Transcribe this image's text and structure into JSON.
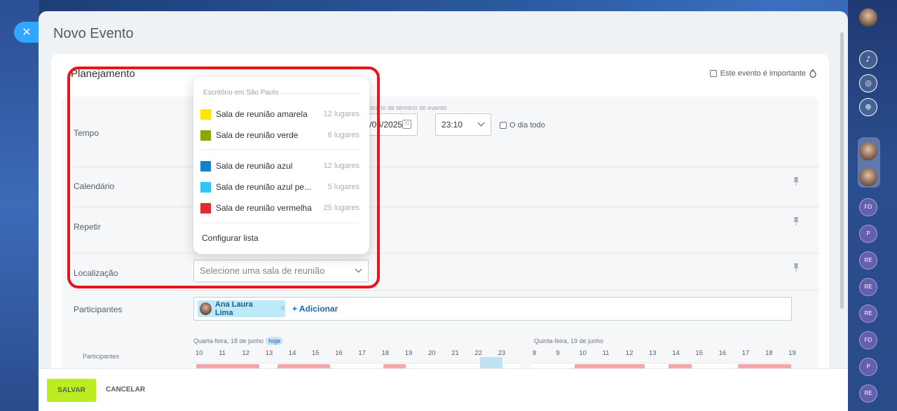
{
  "slider": {
    "title": "Novo Evento"
  },
  "form": {
    "section_title": "Planejamento",
    "important_label": "Este evento é importante",
    "rows": {
      "time_label": "Tempo",
      "calendar_label": "Calendário",
      "repeat_label": "Repetir",
      "location_label": "Localização",
      "participants_label": "Participantes"
    },
    "end_time_caption": "Horário de término do evento",
    "end_date": "19/06/2025",
    "end_time": "23:10",
    "all_day_label": "O dia todo",
    "location_placeholder": "Selecione uma sala de reunião",
    "participant_chip": "Ana Laura Lima",
    "add_link": "+ Adicionar"
  },
  "timeline": {
    "day1_label": "Quarta-feira, 18 de junho",
    "today_badge": "hoje",
    "day2_label": "Quinta-feira, 19 de junho",
    "participants_small": "Participantes",
    "day1_hours": [
      "10",
      "11",
      "12",
      "13",
      "14",
      "15",
      "16",
      "17",
      "18",
      "19",
      "20",
      "21",
      "22",
      "23"
    ],
    "day2_hours": [
      "8",
      "9",
      "10",
      "11",
      "12",
      "13",
      "14",
      "15",
      "16",
      "17",
      "18",
      "19"
    ]
  },
  "dropdown": {
    "header": "Escritório em São Paulo",
    "rooms": [
      {
        "name": "Sala de reunião amarela",
        "capacity": "12 lugares",
        "color": "#ffe600"
      },
      {
        "name": "Sala de reunião verde",
        "capacity": "6 lugares",
        "color": "#86a800"
      },
      {
        "name": "Sala de reunião azul",
        "capacity": "12 lugares",
        "color": "#1283c8"
      },
      {
        "name": "Sala de reunião azul pe...",
        "capacity": "5 lugares",
        "color": "#2fc6f5"
      },
      {
        "name": "Sala de reunião vermelha",
        "capacity": "25 lugares",
        "color": "#e32b2b"
      }
    ],
    "configure": "Configurar lista"
  },
  "footer": {
    "save": "SALVAR",
    "cancel": "CANCELAR"
  },
  "right_panel": {
    "circles": [
      "FD",
      "P",
      "RE",
      "RE",
      "RE",
      "FD",
      "P",
      "RE"
    ]
  },
  "colors": {
    "highlight": "#e8161c",
    "save_button": "#bbed21",
    "close_button": "#2fa7ff"
  }
}
